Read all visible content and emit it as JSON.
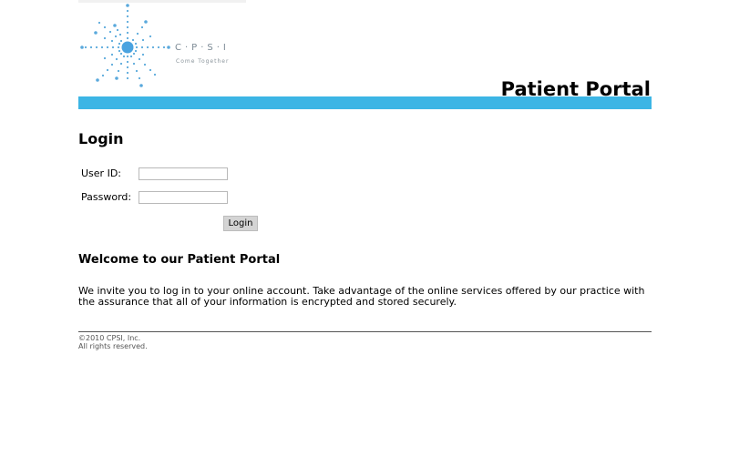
{
  "header": {
    "logo": {
      "brand": "C·P·S·I",
      "tagline": "Come Together"
    },
    "title": "Patient Portal",
    "accent_color": "#3cb5e5"
  },
  "login": {
    "heading": "Login",
    "user_id_label": "User ID:",
    "user_id_value": "",
    "password_label": "Password:",
    "password_value": "",
    "submit_label": "Login"
  },
  "welcome": {
    "heading": "Welcome to our Patient Portal",
    "body": "We invite you to log in to your online account. Take advantage of the online services offered by our practice with the assurance that all of your information is encrypted and stored securely."
  },
  "footer": {
    "copyright": "©2010 CPSI, Inc.",
    "rights": "All rights reserved."
  }
}
